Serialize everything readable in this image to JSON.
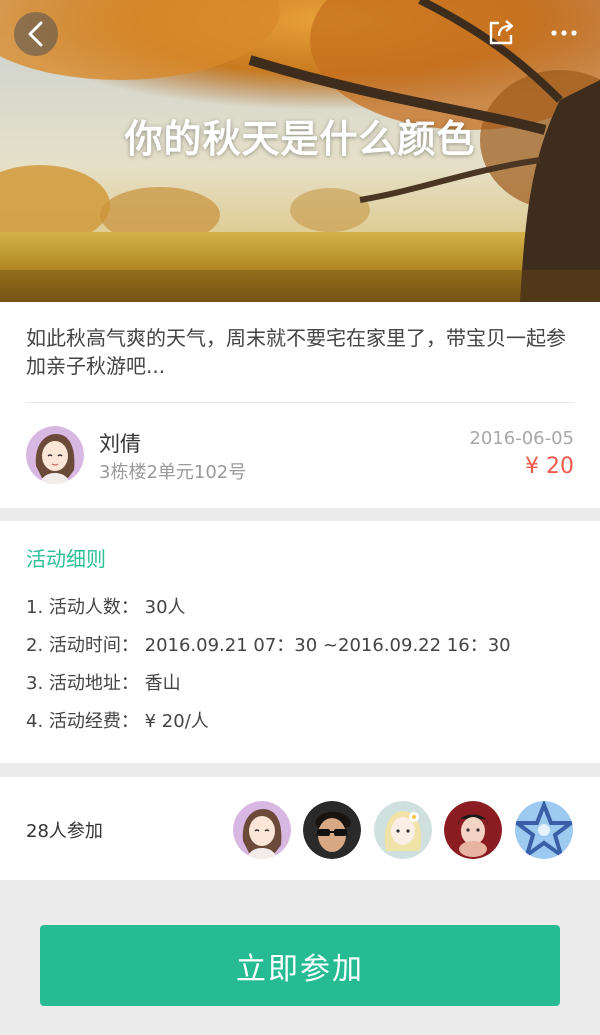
{
  "colors": {
    "accent": "#26bb93",
    "section_title": "#2bbf98",
    "price": "#f05a4a",
    "page_bg": "#ebebeb"
  },
  "header": {
    "title": "你的秋天是什么颜色",
    "back_icon": "chevron-left-icon",
    "share_icon": "share-icon",
    "more_icon": "more-dots-icon"
  },
  "intro": {
    "description": "如此秋高气爽的天气，周末就不要宅在家里了，带宝贝一起参加亲子秋游吧...",
    "host": {
      "name": "刘倩",
      "address": "3栋楼2单元102号"
    },
    "date": "2016-06-05",
    "price": "¥ 20"
  },
  "rules": {
    "title": "活动细则",
    "items": [
      "1. 活动人数：  30人",
      "2. 活动时间：  2016.09.21 07：30 ~2016.09.22 16：30",
      "3. 活动地址：  香山",
      "4. 活动经费：  ¥ 20/人"
    ]
  },
  "participants": {
    "count_label": "28人参加"
  },
  "cta": {
    "join_label": "立即参加"
  }
}
